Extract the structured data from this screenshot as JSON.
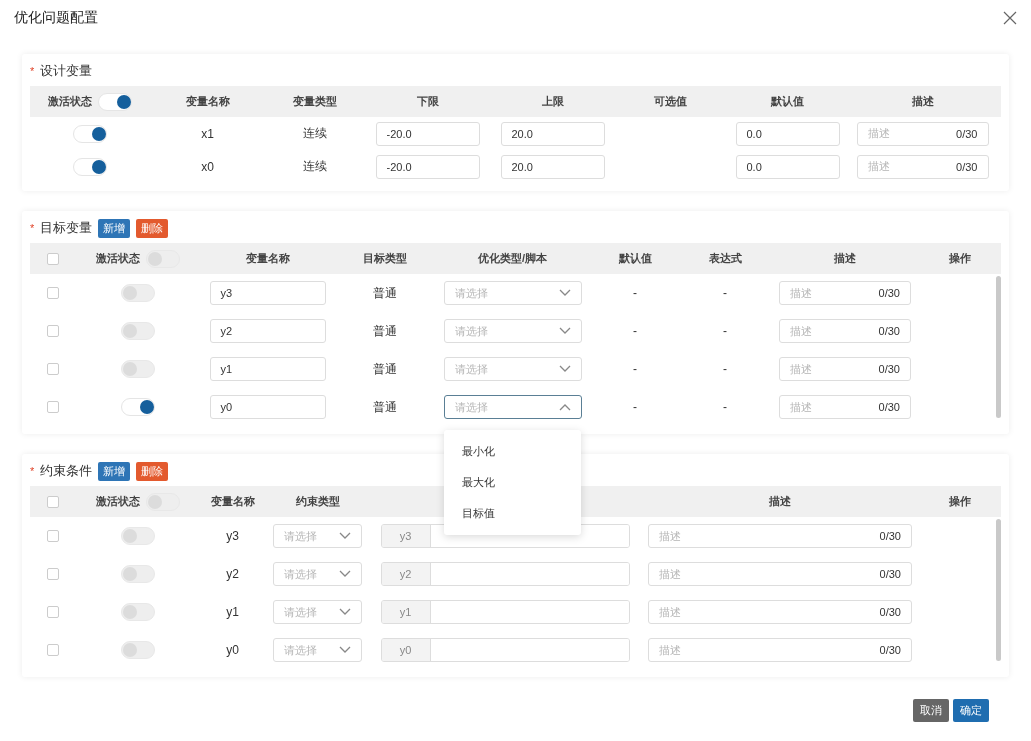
{
  "dialog": {
    "title": "优化问题配置"
  },
  "design_variables": {
    "required_mark": "*",
    "title": "设计变量",
    "header_toggle_on": true,
    "columns": [
      "激活状态",
      "变量名称",
      "变量类型",
      "下限",
      "上限",
      "可选值",
      "默认值",
      "描述"
    ],
    "rows": [
      {
        "active": true,
        "name": "x1",
        "type": "连续",
        "lower": "-20.0",
        "upper": "20.0",
        "default": "0.0",
        "description_placeholder": "描述",
        "counter": "0/30"
      },
      {
        "active": true,
        "name": "x0",
        "type": "连续",
        "lower": "-20.0",
        "upper": "20.0",
        "default": "0.0",
        "description_placeholder": "描述",
        "counter": "0/30"
      }
    ]
  },
  "objectives": {
    "required_mark": "*",
    "title": "目标变量",
    "buttons": [
      {
        "label": "新增",
        "kind": "add"
      },
      {
        "label": "删除",
        "kind": "delete"
      }
    ],
    "header_checked": false,
    "header_toggle_on": false,
    "columns": [
      "激活状态",
      "变量名称",
      "目标类型",
      "优化类型/脚本",
      "默认值",
      "表达式",
      "描述",
      "操作"
    ],
    "rows": [
      {
        "checked": false,
        "active": false,
        "name": "y3",
        "target_type": "普通",
        "select_placeholder": "请选择",
        "open": false,
        "default": "-",
        "expression": "-",
        "description_placeholder": "描述",
        "counter": "0/30"
      },
      {
        "checked": false,
        "active": false,
        "name": "y2",
        "target_type": "普通",
        "select_placeholder": "请选择",
        "open": false,
        "default": "-",
        "expression": "-",
        "description_placeholder": "描述",
        "counter": "0/30"
      },
      {
        "checked": false,
        "active": false,
        "name": "y1",
        "target_type": "普通",
        "select_placeholder": "请选择",
        "open": false,
        "default": "-",
        "expression": "-",
        "description_placeholder": "描述",
        "counter": "0/30"
      },
      {
        "checked": false,
        "active": true,
        "name": "y0",
        "target_type": "普通",
        "select_placeholder": "请选择",
        "open": true,
        "default": "-",
        "expression": "-",
        "description_placeholder": "描述",
        "counter": "0/30"
      }
    ],
    "dropdown_options": [
      "最小化",
      "最大化",
      "目标值"
    ]
  },
  "constraints": {
    "required_mark": "*",
    "title": "约束条件",
    "buttons": [
      {
        "label": "新增",
        "kind": "add"
      },
      {
        "label": "删除",
        "kind": "delete"
      }
    ],
    "header_checked": false,
    "header_toggle_on": false,
    "columns": [
      "激活状态",
      "变量名称",
      "约束类型",
      "描述",
      "操作"
    ],
    "rows": [
      {
        "checked": false,
        "active": false,
        "name": "y3",
        "select_placeholder": "请选择",
        "prefix": "y3",
        "description_placeholder": "描述",
        "counter": "0/30"
      },
      {
        "checked": false,
        "active": false,
        "name": "y2",
        "select_placeholder": "请选择",
        "prefix": "y2",
        "description_placeholder": "描述",
        "counter": "0/30"
      },
      {
        "checked": false,
        "active": false,
        "name": "y1",
        "select_placeholder": "请选择",
        "prefix": "y1",
        "description_placeholder": "描述",
        "counter": "0/30"
      },
      {
        "checked": false,
        "active": false,
        "name": "y0",
        "select_placeholder": "请选择",
        "prefix": "y0",
        "description_placeholder": "描述",
        "counter": "0/30"
      }
    ]
  },
  "footer": {
    "buttons": [
      {
        "label": "取消",
        "kind": "cancel"
      },
      {
        "label": "确定",
        "kind": "primary"
      }
    ]
  }
}
